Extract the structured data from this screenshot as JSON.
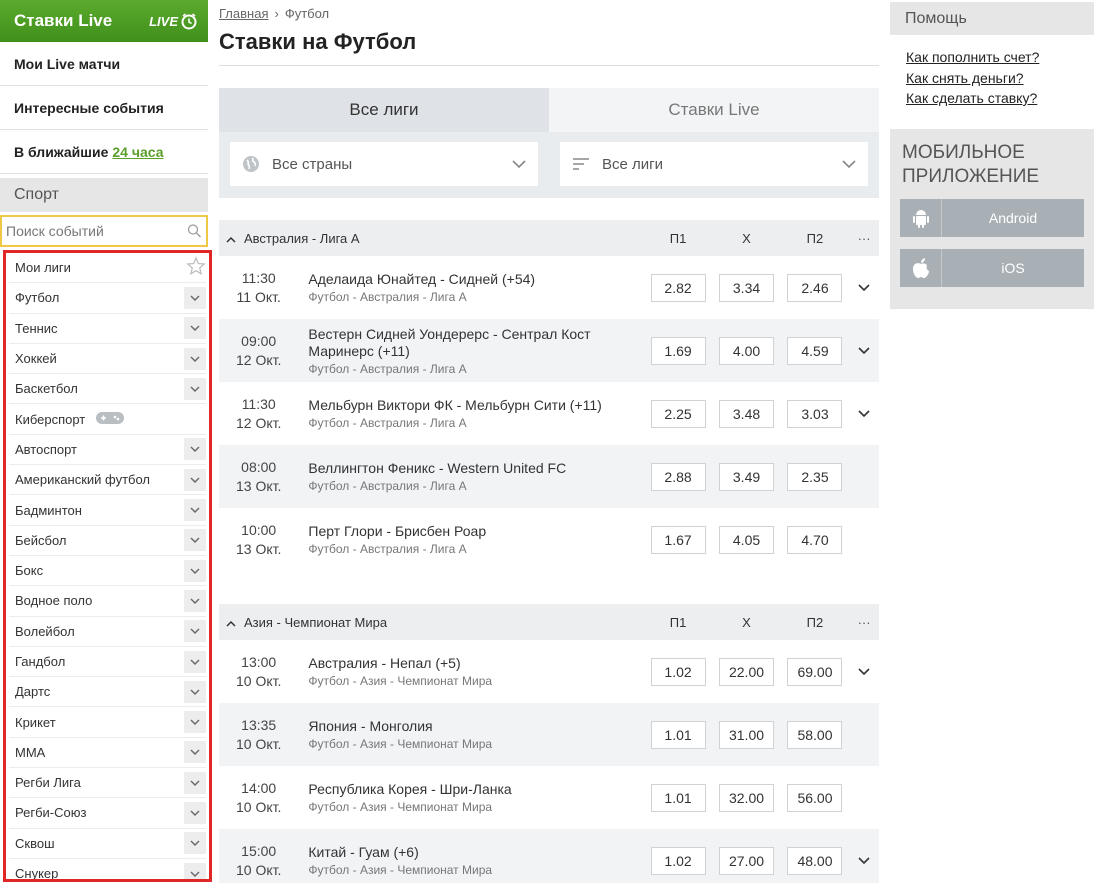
{
  "live_header": {
    "title": "Ставки Live",
    "logo_text": "LIVE"
  },
  "quick_links": {
    "my_live": "Мои Live матчи",
    "interesting": "Интересные события",
    "upcoming_prefix": "В ближайшие",
    "upcoming_link": "24 часа"
  },
  "sport_header": "Спорт",
  "search": {
    "placeholder": "Поиск событий"
  },
  "sports": [
    {
      "label": "Мои лиги",
      "icon": "star-icon"
    },
    {
      "label": "Футбол",
      "icon": "chevron-down-icon"
    },
    {
      "label": "Теннис",
      "icon": "chevron-down-icon"
    },
    {
      "label": "Хоккей",
      "icon": "chevron-down-icon"
    },
    {
      "label": "Баскетбол",
      "icon": "chevron-down-icon"
    },
    {
      "label": "Киберспорт",
      "icon": "gamepad-icon"
    },
    {
      "label": "Автоспорт",
      "icon": "chevron-down-icon"
    },
    {
      "label": "Американский футбол",
      "icon": "chevron-down-icon"
    },
    {
      "label": "Бадминтон",
      "icon": "chevron-down-icon"
    },
    {
      "label": "Бейсбол",
      "icon": "chevron-down-icon"
    },
    {
      "label": "Бокс",
      "icon": "chevron-down-icon"
    },
    {
      "label": "Водное поло",
      "icon": "chevron-down-icon"
    },
    {
      "label": "Волейбол",
      "icon": "chevron-down-icon"
    },
    {
      "label": "Гандбол",
      "icon": "chevron-down-icon"
    },
    {
      "label": "Дартс",
      "icon": "chevron-down-icon"
    },
    {
      "label": "Крикет",
      "icon": "chevron-down-icon"
    },
    {
      "label": "MMA",
      "icon": "chevron-down-icon"
    },
    {
      "label": "Регби Лига",
      "icon": "chevron-down-icon"
    },
    {
      "label": "Регби-Союз",
      "icon": "chevron-down-icon"
    },
    {
      "label": "Сквош",
      "icon": "chevron-down-icon"
    },
    {
      "label": "Снукер",
      "icon": "chevron-down-icon"
    }
  ],
  "breadcrumb": {
    "home": "Главная",
    "separator": "›",
    "current": "Футбол"
  },
  "page_title": "Ставки на Футбол",
  "tabs": [
    {
      "label": "Все лиги",
      "active": true
    },
    {
      "label": "Ставки Live",
      "active": false
    }
  ],
  "filters": {
    "countries": "Все страны",
    "leagues": "Все лиги"
  },
  "columns": {
    "p1": "П1",
    "x": "X",
    "p2": "П2",
    "more": "···"
  },
  "leagues": [
    {
      "name": "Австралия - Лига А",
      "matches": [
        {
          "time": "11:30",
          "date": "11 Окт.",
          "teams": "Аделаида Юнайтед - Сидней (+54)",
          "league": "Футбол - Австралия - Лига А",
          "p1": "2.82",
          "x": "3.34",
          "p2": "2.46",
          "expand": true
        },
        {
          "time": "09:00",
          "date": "12 Окт.",
          "teams": "Вестерн Сидней Уондерерс - Сентрал Кост Маринерс (+11)",
          "league": "Футбол - Австралия - Лига А",
          "p1": "1.69",
          "x": "4.00",
          "p2": "4.59",
          "expand": true
        },
        {
          "time": "11:30",
          "date": "12 Окт.",
          "teams": "Мельбурн Виктори ФК - Мельбурн Сити (+11)",
          "league": "Футбол - Австралия - Лига А",
          "p1": "2.25",
          "x": "3.48",
          "p2": "3.03",
          "expand": true
        },
        {
          "time": "08:00",
          "date": "13 Окт.",
          "teams": "Веллингтон Феникс - Western United FC",
          "league": "Футбол - Австралия - Лига А",
          "p1": "2.88",
          "x": "3.49",
          "p2": "2.35",
          "expand": false
        },
        {
          "time": "10:00",
          "date": "13 Окт.",
          "teams": "Перт Глори - Брисбен Роар",
          "league": "Футбол - Австралия - Лига А",
          "p1": "1.67",
          "x": "4.05",
          "p2": "4.70",
          "expand": false
        }
      ]
    },
    {
      "name": "Азия - Чемпионат Мира",
      "matches": [
        {
          "time": "13:00",
          "date": "10 Окт.",
          "teams": "Австралия - Непал (+5)",
          "league": "Футбол - Азия - Чемпионат Мира",
          "p1": "1.02",
          "x": "22.00",
          "p2": "69.00",
          "expand": true
        },
        {
          "time": "13:35",
          "date": "10 Окт.",
          "teams": "Япония - Монголия",
          "league": "Футбол - Азия - Чемпионат Мира",
          "p1": "1.01",
          "x": "31.00",
          "p2": "58.00",
          "expand": false
        },
        {
          "time": "14:00",
          "date": "10 Окт.",
          "teams": "Республика Корея - Шри-Ланка",
          "league": "Футбол - Азия - Чемпионат Мира",
          "p1": "1.01",
          "x": "32.00",
          "p2": "56.00",
          "expand": false
        },
        {
          "time": "15:00",
          "date": "10 Окт.",
          "teams": "Китай - Гуам (+6)",
          "league": "Футбол - Азия - Чемпионат Мира",
          "p1": "1.02",
          "x": "27.00",
          "p2": "48.00",
          "expand": true
        }
      ]
    }
  ],
  "help": {
    "title": "Помощь",
    "links": [
      "Как пополнить счет?",
      "Как снять деньги?",
      "Как сделать ставку?"
    ]
  },
  "mobile": {
    "title_line1": "МОБИЛЬНОЕ",
    "title_line2": "ПРИЛОЖЕНИЕ",
    "android": "Android",
    "ios": "iOS"
  },
  "colors": {
    "live_green": "#4f9e25",
    "accent_link": "#5a9f2a",
    "highlight_yellow": "#f0c848",
    "highlight_red": "#e02626"
  }
}
